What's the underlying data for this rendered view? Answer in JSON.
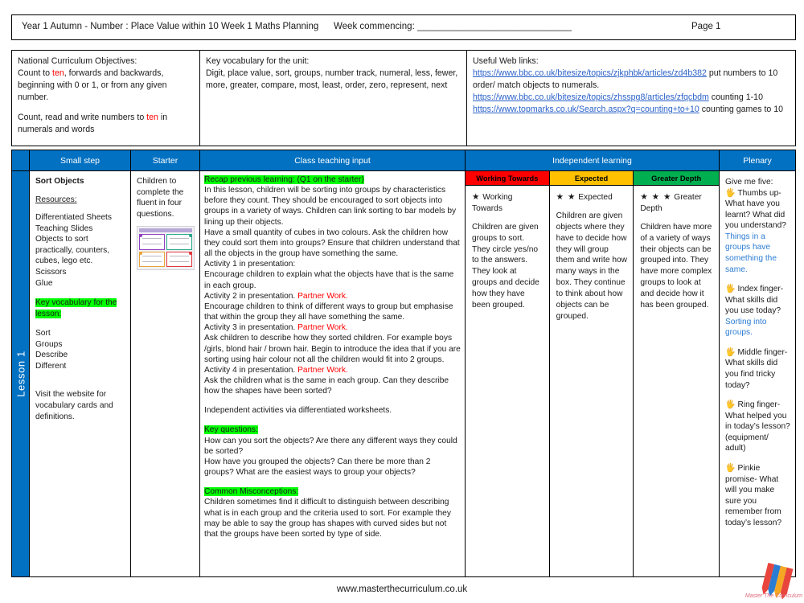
{
  "header": {
    "title": "Year 1 Autumn -  Number : Place Value within 10 Week 1 Maths Planning",
    "week_commencing_label": "Week commencing: ______________________________",
    "page_label": "Page 1"
  },
  "info": {
    "curriculum": {
      "heading": "National Curriculum Objectives:",
      "line1_a": "Count to ",
      "line1_red": "ten",
      "line1_b": ", forwards and backwards, beginning with 0 or 1, or from any given number.",
      "line2_a": "Count, read and write numbers to ",
      "line2_red": "ten",
      "line2_b": " in numerals and words"
    },
    "vocabulary": {
      "heading": "Key vocabulary for the unit:",
      "words": "Digit, place value, sort, groups, number track, numeral, less, fewer, more, greater, compare, most, least, order, zero, represent, next"
    },
    "weblinks": {
      "heading": "Useful Web links:",
      "link1_url": "https://www.bbc.co.uk/bitesize/topics/zjkphbk/articles/zd4b382",
      "link1_note": "put numbers to 10 order/ match objects to numerals.",
      "link2_url": "https://www.bbc.co.uk/bitesize/topics/zhsspg8/articles/zfqcbdm",
      "link2_note": "counting 1-10",
      "link3_url": "https://www.topmarks.co.uk/Search.aspx?q=counting+to+10",
      "link3_note": "counting games to 10"
    }
  },
  "table": {
    "headers": {
      "small_step": "Small step",
      "starter": "Starter",
      "class_input": "Class teaching input",
      "independent": "Independent learning",
      "plenary": "Plenary"
    },
    "lesson_tab": "Lesson 1",
    "small_step": {
      "title": "Sort Objects",
      "resources_heading": "Resources:",
      "resources": [
        "Differentiated Sheets",
        "Teaching Slides",
        "Objects to sort practically, counters, cubes, lego etc.",
        "Scissors",
        "Glue"
      ],
      "key_vocab_heading": "Key vocabulary for the lesson:",
      "key_vocab": [
        "Sort",
        "Groups",
        "Describe",
        "Different"
      ],
      "footer_note": "Visit the website for vocabulary cards and definitions."
    },
    "starter": {
      "text": "Children to complete the fluent in four questions.",
      "thumbnail_name": "fluent-in-four-slide-thumbnail"
    },
    "class_input": {
      "recap_heading": "Recap previous learning: (Q1 on the starter)",
      "intro": "In this lesson, children will be sorting into groups by characteristics before they count. They should be encouraged to sort objects into groups in a variety of ways. Children can link sorting to bar models by lining up their objects.",
      "cubes": "Have a small quantity of cubes in two colours. Ask the children how they could sort them into groups? Ensure that children understand that all the objects in the group have something the same.",
      "activity1_label": "Activity 1 in presentation:",
      "activity1_text": "Encourage children to explain what the objects have that is the same in each group.",
      "activity2_label": "Activity 2 in presentation.",
      "activity2_tag": "Partner Work.",
      "activity2_text": "Encourage children to think of different ways to group but emphasise that within the group they all have something the same.",
      "activity3_label": "Activity 3 in presentation.",
      "activity3_tag": "Partner Work.",
      "activity3_text": "Ask children to describe how they sorted children. For example boys /girls, blond hair / brown hair. Begin to introduce the idea that if you are sorting using hair colour not all the children would fit into 2 groups.",
      "activity4_label": "Activity 4 in presentation.",
      "activity4_tag": "Partner Work.",
      "activity4_text": "Ask the children what is the same in each group. Can they describe how the shapes have been sorted?",
      "independent_note": "Independent activities via differentiated worksheets.",
      "key_questions_heading": "Key questions:",
      "key_question1": "How can you sort the objects? Are there any different ways they could be sorted?",
      "key_question2": "How have you grouped the objects? Can there be more than 2 groups? What are the easiest ways to group your objects?",
      "misconceptions_heading": "Common Misconceptions:",
      "misconceptions_text": "Children sometimes find it difficult to distinguish between describing what is in each group and the criteria used to sort.  For example they may be able to say the group has shapes with curved sides but not that the groups have been sorted by type of side."
    },
    "independent": [
      {
        "header": "Working Towards",
        "header_color": "#ff0000",
        "stars": "★",
        "star_count": 1,
        "label": "Working Towards",
        "body": "Children are given groups to sort. They circle yes/no to the answers. They look at groups and decide how they have been grouped."
      },
      {
        "header": "Expected",
        "header_color": "#ffc000",
        "stars": "★ ★",
        "star_count": 2,
        "label": "Expected",
        "body": "Children are given objects where they have to decide how they will group them and write how many ways in the box. They continue to think about how objects can be grouped."
      },
      {
        "header": "Greater Depth",
        "header_color": "#00b050",
        "stars": "★ ★ ★",
        "star_count": 3,
        "label": "Greater Depth",
        "body": "Children have more of a variety of ways their objects can be grouped into. They have more complex groups to look at and decide how it has been grouped."
      }
    ],
    "plenary": {
      "heading": "Give me five:",
      "items": [
        {
          "icon": "hand-icon",
          "question": "Thumbs up- What have you learnt? What did you understand?",
          "answer": "Things in a groups have something the same."
        },
        {
          "icon": "hand-icon",
          "question": "Index finger- What skills did you use today?",
          "answer": "Sorting into groups."
        },
        {
          "icon": "hand-icon",
          "question": "Middle finger- What skills did you find tricky today?",
          "answer": ""
        },
        {
          "icon": "hand-icon",
          "question": "Ring finger- What helped you in today’s lesson? (equipment/ adult)",
          "answer": ""
        },
        {
          "icon": "hand-icon",
          "question": "Pinkie promise- What will you make sure you remember from today’s lesson?",
          "answer": ""
        }
      ]
    }
  },
  "footer": {
    "url": "www.masterthecurriculum.co.uk",
    "logo_script": "Master The Curriculum"
  }
}
